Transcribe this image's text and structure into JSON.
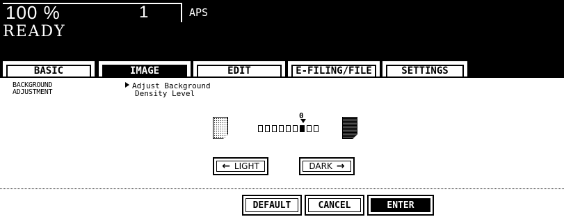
{
  "header": {
    "copy_percent": "100 %",
    "copy_count": "1",
    "paper_mode": "APS",
    "status": "READY"
  },
  "tabs": [
    {
      "label": "BASIC",
      "active": false
    },
    {
      "label": "IMAGE",
      "active": true
    },
    {
      "label": "EDIT",
      "active": false
    },
    {
      "label": "E-FILING/FILE",
      "active": false
    },
    {
      "label": "SETTINGS",
      "active": false
    }
  ],
  "panel": {
    "section_title_line1": "BACKGROUND",
    "section_title_line2": "ADJUSTMENT",
    "instruction_line1": "Adjust Background",
    "instruction_line2": "Density Level"
  },
  "density": {
    "value_label": "0",
    "steps": 9,
    "selected_index": 6,
    "light_icon": "light-page-icon",
    "dark_icon": "dark-page-icon"
  },
  "buttons": {
    "light": "LIGHT",
    "dark": "DARK",
    "default": "DEFAULT",
    "cancel": "CANCEL",
    "enter": "ENTER"
  },
  "colors": {
    "background": "#ffffff",
    "header_bg": "#000000",
    "foreground": "#000000"
  }
}
